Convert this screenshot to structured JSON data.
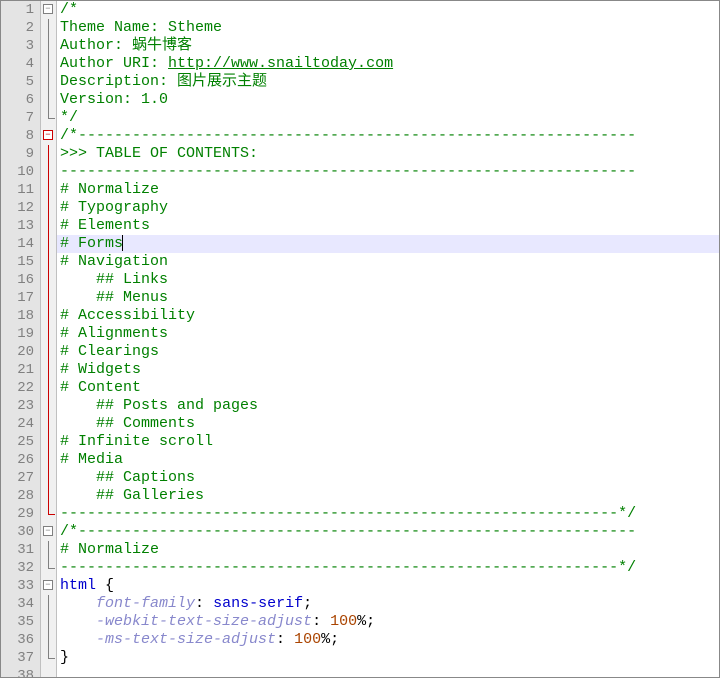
{
  "editor": {
    "lines": [
      {
        "n": 1,
        "fold": "open",
        "seg": [
          {
            "t": "/*",
            "cls": "c-comment"
          }
        ]
      },
      {
        "n": 2,
        "fold": "vert",
        "seg": [
          {
            "t": "Theme Name: Stheme",
            "cls": "c-comment"
          }
        ]
      },
      {
        "n": 3,
        "fold": "vert",
        "seg": [
          {
            "t": "Author: 蜗牛博客",
            "cls": "c-comment"
          }
        ]
      },
      {
        "n": 4,
        "fold": "vert",
        "seg": [
          {
            "t": "Author URI: ",
            "cls": "c-comment"
          },
          {
            "t": "http://www.snailtoday.com",
            "cls": "c-link"
          }
        ]
      },
      {
        "n": 5,
        "fold": "vert",
        "seg": [
          {
            "t": "Description: 图片展示主题",
            "cls": "c-comment"
          }
        ]
      },
      {
        "n": 6,
        "fold": "vert",
        "seg": [
          {
            "t": "Version: 1.0",
            "cls": "c-comment"
          }
        ]
      },
      {
        "n": 7,
        "fold": "end",
        "seg": [
          {
            "t": "*/",
            "cls": "c-comment"
          }
        ]
      },
      {
        "n": 8,
        "fold": "open-red",
        "seg": [
          {
            "t": "/*--------------------------------------------------------------",
            "cls": "c-comment"
          }
        ]
      },
      {
        "n": 9,
        "fold": "vert-red",
        "seg": [
          {
            "t": ">>> TABLE OF CONTENTS:",
            "cls": "c-comment"
          }
        ]
      },
      {
        "n": 10,
        "fold": "vert-red",
        "seg": [
          {
            "t": "----------------------------------------------------------------",
            "cls": "c-comment"
          }
        ]
      },
      {
        "n": 11,
        "fold": "vert-red",
        "seg": [
          {
            "t": "# Normalize",
            "cls": "c-comment"
          }
        ]
      },
      {
        "n": 12,
        "fold": "vert-red",
        "seg": [
          {
            "t": "# Typography",
            "cls": "c-comment"
          }
        ]
      },
      {
        "n": 13,
        "fold": "vert-red",
        "seg": [
          {
            "t": "# Elements",
            "cls": "c-comment"
          }
        ]
      },
      {
        "n": 14,
        "fold": "vert-red",
        "hl": true,
        "seg": [
          {
            "t": "# Forms",
            "cls": "c-comment"
          }
        ],
        "cursor": true
      },
      {
        "n": 15,
        "fold": "vert-red",
        "seg": [
          {
            "t": "# Navigation",
            "cls": "c-comment"
          }
        ]
      },
      {
        "n": 16,
        "fold": "vert-red",
        "seg": [
          {
            "t": "    ## Links",
            "cls": "c-comment"
          }
        ]
      },
      {
        "n": 17,
        "fold": "vert-red",
        "seg": [
          {
            "t": "    ## Menus",
            "cls": "c-comment"
          }
        ]
      },
      {
        "n": 18,
        "fold": "vert-red",
        "seg": [
          {
            "t": "# Accessibility",
            "cls": "c-comment"
          }
        ]
      },
      {
        "n": 19,
        "fold": "vert-red",
        "seg": [
          {
            "t": "# Alignments",
            "cls": "c-comment"
          }
        ]
      },
      {
        "n": 20,
        "fold": "vert-red",
        "seg": [
          {
            "t": "# Clearings",
            "cls": "c-comment"
          }
        ]
      },
      {
        "n": 21,
        "fold": "vert-red",
        "seg": [
          {
            "t": "# Widgets",
            "cls": "c-comment"
          }
        ]
      },
      {
        "n": 22,
        "fold": "vert-red",
        "seg": [
          {
            "t": "# Content",
            "cls": "c-comment"
          }
        ]
      },
      {
        "n": 23,
        "fold": "vert-red",
        "seg": [
          {
            "t": "    ## Posts and pages",
            "cls": "c-comment"
          }
        ]
      },
      {
        "n": 24,
        "fold": "vert-red",
        "seg": [
          {
            "t": "    ## Comments",
            "cls": "c-comment"
          }
        ]
      },
      {
        "n": 25,
        "fold": "vert-red",
        "seg": [
          {
            "t": "# Infinite scroll",
            "cls": "c-comment"
          }
        ]
      },
      {
        "n": 26,
        "fold": "vert-red",
        "seg": [
          {
            "t": "# Media",
            "cls": "c-comment"
          }
        ]
      },
      {
        "n": 27,
        "fold": "vert-red",
        "seg": [
          {
            "t": "    ## Captions",
            "cls": "c-comment"
          }
        ]
      },
      {
        "n": 28,
        "fold": "vert-red",
        "seg": [
          {
            "t": "    ## Galleries",
            "cls": "c-comment"
          }
        ]
      },
      {
        "n": 29,
        "fold": "end-red",
        "seg": [
          {
            "t": "--------------------------------------------------------------*/",
            "cls": "c-comment"
          }
        ]
      },
      {
        "n": 30,
        "fold": "open",
        "seg": [
          {
            "t": "/*--------------------------------------------------------------",
            "cls": "c-comment"
          }
        ]
      },
      {
        "n": 31,
        "fold": "vert",
        "seg": [
          {
            "t": "# Normalize",
            "cls": "c-comment"
          }
        ]
      },
      {
        "n": 32,
        "fold": "end",
        "seg": [
          {
            "t": "--------------------------------------------------------------*/",
            "cls": "c-comment"
          }
        ]
      },
      {
        "n": 33,
        "fold": "open",
        "seg": [
          {
            "t": "html",
            "cls": "c-keyword"
          },
          {
            "t": " {",
            "cls": "c-brace"
          }
        ]
      },
      {
        "n": 34,
        "fold": "vert",
        "seg": [
          {
            "t": "    ",
            "cls": ""
          },
          {
            "t": "font-family",
            "cls": "c-prop"
          },
          {
            "t": ": ",
            "cls": "c-punct"
          },
          {
            "t": "sans-serif",
            "cls": "c-keyword"
          },
          {
            "t": ";",
            "cls": "c-punct"
          }
        ]
      },
      {
        "n": 35,
        "fold": "vert",
        "seg": [
          {
            "t": "    ",
            "cls": ""
          },
          {
            "t": "-webkit-text-size-adjust",
            "cls": "c-prop"
          },
          {
            "t": ": ",
            "cls": "c-punct"
          },
          {
            "t": "100",
            "cls": "c-num"
          },
          {
            "t": "%;",
            "cls": "c-punct"
          }
        ]
      },
      {
        "n": 36,
        "fold": "vert",
        "seg": [
          {
            "t": "    ",
            "cls": ""
          },
          {
            "t": "-ms-text-size-adjust",
            "cls": "c-prop"
          },
          {
            "t": ": ",
            "cls": "c-punct"
          },
          {
            "t": "100",
            "cls": "c-num"
          },
          {
            "t": "%;",
            "cls": "c-punct"
          }
        ]
      },
      {
        "n": 37,
        "fold": "end",
        "seg": [
          {
            "t": "}",
            "cls": "c-brace"
          }
        ]
      },
      {
        "n": 38,
        "fold": "",
        "seg": [
          {
            "t": "",
            "cls": ""
          }
        ]
      }
    ]
  }
}
